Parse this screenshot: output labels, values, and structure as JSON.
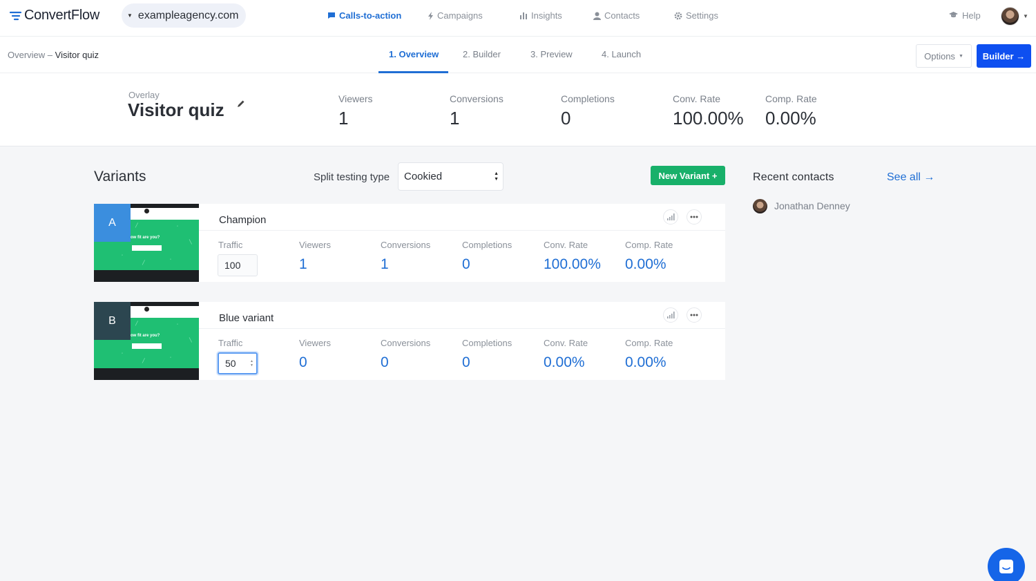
{
  "brand": {
    "name": "ConvertFlow",
    "accent": "#1f6ed4",
    "primary_button": "#0e4ff0",
    "success": "#18b06a"
  },
  "domain_selector": {
    "value": "exampleagency.com"
  },
  "nav": {
    "items": [
      {
        "label": "Calls-to-action",
        "icon": "chat-bubble-icon",
        "active": true
      },
      {
        "label": "Campaigns",
        "icon": "bolt-icon",
        "active": false
      },
      {
        "label": "Insights",
        "icon": "bar-chart-icon",
        "active": false
      },
      {
        "label": "Contacts",
        "icon": "user-icon",
        "active": false
      },
      {
        "label": "Settings",
        "icon": "gear-icon",
        "active": false
      }
    ],
    "help": "Help"
  },
  "subbar": {
    "breadcrumb_parent": "Overview",
    "breadcrumb_sep": " – ",
    "breadcrumb_current": "Visitor quiz",
    "steps": [
      "1. Overview",
      "2. Builder",
      "3. Preview",
      "4. Launch"
    ],
    "active_step": 0,
    "options_label": "Options",
    "builder_label": "Builder →"
  },
  "summary": {
    "type_label": "Overlay",
    "title": "Visitor quiz",
    "stats": [
      {
        "label": "Viewers",
        "value": "1"
      },
      {
        "label": "Conversions",
        "value": "1"
      },
      {
        "label": "Completions",
        "value": "0"
      },
      {
        "label": "Conv. Rate",
        "value": "100.00%"
      },
      {
        "label": "Comp. Rate",
        "value": "0.00%"
      }
    ]
  },
  "variants": {
    "title": "Variants",
    "split_label": "Split testing type",
    "split_value": "Cookied",
    "new_variant_label": "New Variant +",
    "column_labels": [
      "Traffic",
      "Viewers",
      "Conversions",
      "Completions",
      "Conv. Rate",
      "Comp. Rate"
    ],
    "thumbnail_text": "ow fit are you?",
    "items": [
      {
        "letter": "A",
        "badge_color": "#3b8ede",
        "name": "Champion",
        "traffic": "100",
        "viewers": "1",
        "conversions": "1",
        "completions": "0",
        "conv_rate": "100.00%",
        "comp_rate": "0.00%",
        "focused": false
      },
      {
        "letter": "B",
        "badge_color": "#2c4650",
        "name": "Blue variant",
        "traffic": "50",
        "viewers": "0",
        "conversions": "0",
        "completions": "0",
        "conv_rate": "0.00%",
        "comp_rate": "0.00%",
        "focused": true
      }
    ]
  },
  "recent_contacts": {
    "title": "Recent contacts",
    "see_all": "See all →",
    "items": [
      {
        "name": "Jonathan Denney"
      }
    ]
  }
}
